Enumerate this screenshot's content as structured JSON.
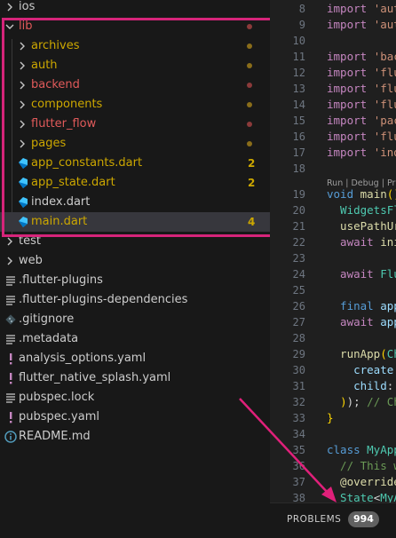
{
  "explorer": {
    "items": [
      {
        "label": "ios",
        "kind": "folder",
        "expanded": false,
        "color": "#cccccc",
        "badge": "",
        "dot": ""
      },
      {
        "label": "lib",
        "kind": "folder",
        "expanded": true,
        "color": "#e05a5a",
        "badge": "",
        "dot": "#8b3a3a"
      },
      {
        "label": "archives",
        "kind": "folder",
        "expanded": false,
        "color": "#cca700",
        "badge": "",
        "dot": "#8a6d1a"
      },
      {
        "label": "auth",
        "kind": "folder",
        "expanded": false,
        "color": "#cca700",
        "badge": "",
        "dot": "#8a6d1a"
      },
      {
        "label": "backend",
        "kind": "folder",
        "expanded": false,
        "color": "#e05a5a",
        "badge": "",
        "dot": "#8b3a3a"
      },
      {
        "label": "components",
        "kind": "folder",
        "expanded": false,
        "color": "#cca700",
        "badge": "",
        "dot": "#8a6d1a"
      },
      {
        "label": "flutter_flow",
        "kind": "folder",
        "expanded": false,
        "color": "#e05a5a",
        "badge": "",
        "dot": "#8b3a3a"
      },
      {
        "label": "pages",
        "kind": "folder",
        "expanded": false,
        "color": "#cca700",
        "badge": "",
        "dot": "#8a6d1a"
      },
      {
        "label": "app_constants.dart",
        "kind": "dart",
        "color": "#cca700",
        "badge": "2",
        "dot": ""
      },
      {
        "label": "app_state.dart",
        "kind": "dart",
        "color": "#cca700",
        "badge": "2",
        "dot": ""
      },
      {
        "label": "index.dart",
        "kind": "dart",
        "color": "#cccccc",
        "badge": "",
        "dot": ""
      },
      {
        "label": "main.dart",
        "kind": "dart",
        "color": "#cca700",
        "badge": "4",
        "dot": "",
        "selected": true
      },
      {
        "label": "test",
        "kind": "folder",
        "expanded": false,
        "color": "#cccccc",
        "badge": "",
        "dot": ""
      },
      {
        "label": "web",
        "kind": "folder",
        "expanded": false,
        "color": "#cccccc",
        "badge": "",
        "dot": ""
      },
      {
        "label": ".flutter-plugins",
        "kind": "lines",
        "color": "#cccccc",
        "badge": "",
        "dot": ""
      },
      {
        "label": ".flutter-plugins-dependencies",
        "kind": "lines",
        "color": "#cccccc",
        "badge": "",
        "dot": ""
      },
      {
        "label": ".gitignore",
        "kind": "git",
        "color": "#cccccc",
        "badge": "",
        "dot": ""
      },
      {
        "label": ".metadata",
        "kind": "lines",
        "color": "#cccccc",
        "badge": "",
        "dot": ""
      },
      {
        "label": "analysis_options.yaml",
        "kind": "yaml",
        "color": "#cccccc",
        "badge": "",
        "dot": ""
      },
      {
        "label": "flutter_native_splash.yaml",
        "kind": "yaml",
        "color": "#cccccc",
        "badge": "",
        "dot": ""
      },
      {
        "label": "pubspec.lock",
        "kind": "lines",
        "color": "#cccccc",
        "badge": "",
        "dot": ""
      },
      {
        "label": "pubspec.yaml",
        "kind": "yaml",
        "color": "#cccccc",
        "badge": "",
        "dot": ""
      },
      {
        "label": "README.md",
        "kind": "info",
        "color": "#cccccc",
        "badge": "",
        "dot": ""
      }
    ]
  },
  "editor": {
    "lines": [
      {
        "n": "8",
        "segs": [
          {
            "t": "import ",
            "c": "kw2"
          },
          {
            "t": "'aut",
            "c": "str"
          }
        ]
      },
      {
        "n": "9",
        "segs": [
          {
            "t": "import ",
            "c": "kw2"
          },
          {
            "t": "'aut",
            "c": "str"
          }
        ]
      },
      {
        "n": "10",
        "segs": []
      },
      {
        "n": "11",
        "segs": [
          {
            "t": "import ",
            "c": "kw2"
          },
          {
            "t": "'bac",
            "c": "str"
          }
        ]
      },
      {
        "n": "12",
        "segs": [
          {
            "t": "import ",
            "c": "kw2"
          },
          {
            "t": "'flu",
            "c": "str"
          }
        ]
      },
      {
        "n": "13",
        "segs": [
          {
            "t": "import ",
            "c": "kw2"
          },
          {
            "t": "'flu",
            "c": "str"
          }
        ]
      },
      {
        "n": "14",
        "segs": [
          {
            "t": "import ",
            "c": "kw2"
          },
          {
            "t": "'flu",
            "c": "str"
          }
        ]
      },
      {
        "n": "15",
        "segs": [
          {
            "t": "import ",
            "c": "kw2"
          },
          {
            "t": "'pac",
            "c": "str"
          }
        ]
      },
      {
        "n": "16",
        "segs": [
          {
            "t": "import ",
            "c": "kw2"
          },
          {
            "t": "'flu",
            "c": "str"
          }
        ]
      },
      {
        "n": "17",
        "segs": [
          {
            "t": "import ",
            "c": "kw2"
          },
          {
            "t": "'ind",
            "c": "str"
          }
        ]
      },
      {
        "n": "18",
        "segs": []
      },
      {
        "n": "19",
        "segs": [
          {
            "t": "void ",
            "c": "kw"
          },
          {
            "t": "main",
            "c": "fn"
          },
          {
            "t": "()",
            "c": "brk"
          }
        ]
      },
      {
        "n": "20",
        "segs": [
          {
            "t": "  WidgetsFl",
            "c": "cls"
          }
        ]
      },
      {
        "n": "21",
        "segs": [
          {
            "t": "  usePathUr",
            "c": "fn"
          }
        ]
      },
      {
        "n": "22",
        "segs": [
          {
            "t": "  await ",
            "c": "kw2"
          },
          {
            "t": "ini",
            "c": "fn"
          }
        ]
      },
      {
        "n": "23",
        "segs": []
      },
      {
        "n": "24",
        "segs": [
          {
            "t": "  await ",
            "c": "kw2"
          },
          {
            "t": "Flu",
            "c": "cls"
          }
        ]
      },
      {
        "n": "25",
        "segs": []
      },
      {
        "n": "26",
        "segs": [
          {
            "t": "  final ",
            "c": "kw"
          },
          {
            "t": "app",
            "c": "var"
          }
        ]
      },
      {
        "n": "27",
        "segs": [
          {
            "t": "  await ",
            "c": "kw2"
          },
          {
            "t": "app",
            "c": "var"
          }
        ]
      },
      {
        "n": "28",
        "segs": []
      },
      {
        "n": "29",
        "segs": [
          {
            "t": "  runApp",
            "c": "fn"
          },
          {
            "t": "(",
            "c": "brk"
          },
          {
            "t": "Ch",
            "c": "cls"
          }
        ]
      },
      {
        "n": "30",
        "segs": [
          {
            "t": "    create",
            "c": "var"
          },
          {
            "t": ":",
            "c": "pl"
          }
        ]
      },
      {
        "n": "31",
        "segs": [
          {
            "t": "    child",
            "c": "var"
          },
          {
            "t": ":",
            "c": "pl"
          }
        ]
      },
      {
        "n": "32",
        "segs": [
          {
            "t": "  ",
            "c": "pl"
          },
          {
            "t": ")",
            "c": "brk"
          },
          {
            "t": "); ",
            "c": "pl"
          },
          {
            "t": "// Ch",
            "c": "cmt"
          }
        ]
      },
      {
        "n": "33",
        "segs": [
          {
            "t": "}",
            "c": "brk"
          }
        ]
      },
      {
        "n": "34",
        "segs": []
      },
      {
        "n": "35",
        "segs": [
          {
            "t": "class ",
            "c": "kw"
          },
          {
            "t": "MyApp",
            "c": "cls"
          }
        ]
      },
      {
        "n": "36",
        "segs": [
          {
            "t": "  // This w",
            "c": "cmt"
          }
        ]
      },
      {
        "n": "37",
        "segs": [
          {
            "t": "  @override",
            "c": "fn"
          }
        ]
      },
      {
        "n": "38",
        "segs": [
          {
            "t": "  State",
            "c": "cls"
          },
          {
            "t": "<",
            "c": "pl"
          },
          {
            "t": "MyA",
            "c": "cls"
          }
        ]
      }
    ],
    "codelens": "Run | Debug | Pr"
  },
  "panel": {
    "problems_label": "PROBLEMS",
    "problems_count": "994"
  }
}
